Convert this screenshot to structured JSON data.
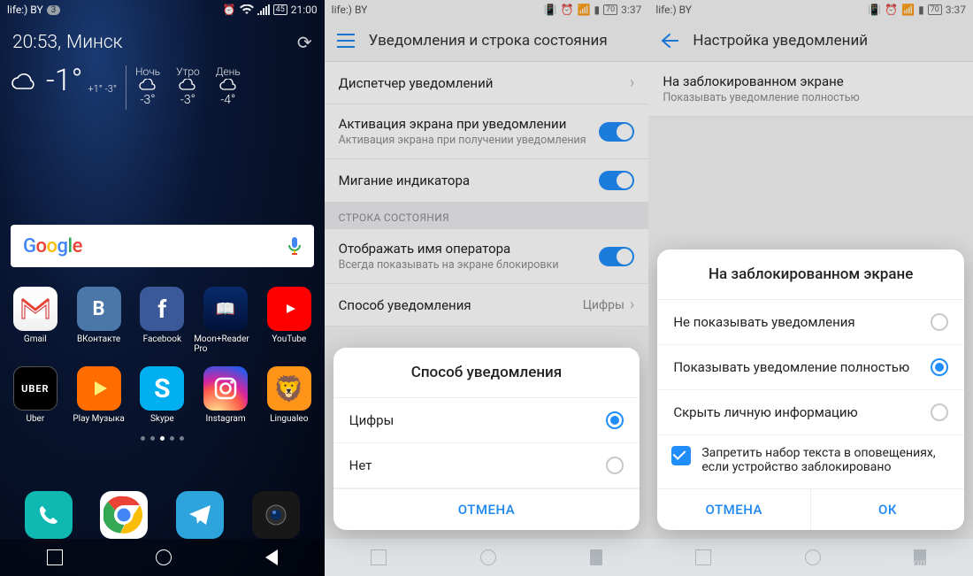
{
  "watermark": "tech.onliner.by",
  "screen1": {
    "status": {
      "carrier": "life:) BY",
      "badge": "3",
      "batt": "45",
      "time": "21:00"
    },
    "clock": {
      "time": "20:53,",
      "city": "Минск"
    },
    "weather": {
      "temp": "-1°",
      "range": "+1° -3°",
      "forecast": [
        {
          "label": "Ночь",
          "deg": "-3°"
        },
        {
          "label": "Утро",
          "deg": "-3°"
        },
        {
          "label": "День",
          "deg": "-4°"
        }
      ]
    },
    "search": {
      "logo_chars": [
        "G",
        "o",
        "o",
        "g",
        "l",
        "e"
      ]
    },
    "apps_row1": [
      {
        "name": "Gmail",
        "cls": "gmail"
      },
      {
        "name": "ВКонтакте",
        "cls": "vk"
      },
      {
        "name": "Facebook",
        "cls": "fb"
      },
      {
        "name": "Moon+Reader Pro",
        "cls": "moon"
      },
      {
        "name": "YouTube",
        "cls": "yt"
      }
    ],
    "apps_row2": [
      {
        "name": "Uber",
        "cls": "uber"
      },
      {
        "name": "Play Музыка",
        "cls": "pm"
      },
      {
        "name": "Skype",
        "cls": "skype"
      },
      {
        "name": "Instagram",
        "cls": "ig"
      },
      {
        "name": "Lingualeo",
        "cls": "ll"
      }
    ]
  },
  "screen2": {
    "status": {
      "carrier": "life:) BY",
      "batt": "70",
      "time": "3:37"
    },
    "header": "Уведомления и строка состояния",
    "rows": {
      "r1": {
        "label": "Диспетчер уведомлений"
      },
      "r2": {
        "label": "Активация экрана при уведомлении",
        "sub": "Активация экрана при получении уведомления"
      },
      "r3": {
        "label": "Мигание индикатора"
      },
      "section": "СТРОКА СОСТОЯНИЯ",
      "r4": {
        "label": "Отображать имя оператора",
        "sub": "Всегда показывать на экране блокировки"
      },
      "r5": {
        "label": "Способ уведомления",
        "value": "Цифры"
      }
    },
    "dialog": {
      "title": "Способ уведомления",
      "opt1": "Цифры",
      "opt2": "Нет",
      "cancel": "ОТМЕНА"
    }
  },
  "screen3": {
    "status": {
      "carrier": "life:) BY",
      "batt": "70",
      "time": "3:37"
    },
    "header": "Настройка уведомлений",
    "row": {
      "label": "На заблокированном экране",
      "sub": "Показывать уведомление полностью"
    },
    "dialog": {
      "title": "На заблокированном экране",
      "opt1": "Не показывать уведомления",
      "opt2": "Показывать уведомление полностью",
      "opt3": "Скрыть личную информацию",
      "checkbox": "Запретить набор текста в оповещениях, если устройство заблокировано",
      "cancel": "ОТМЕНА",
      "ok": "ОК"
    }
  }
}
